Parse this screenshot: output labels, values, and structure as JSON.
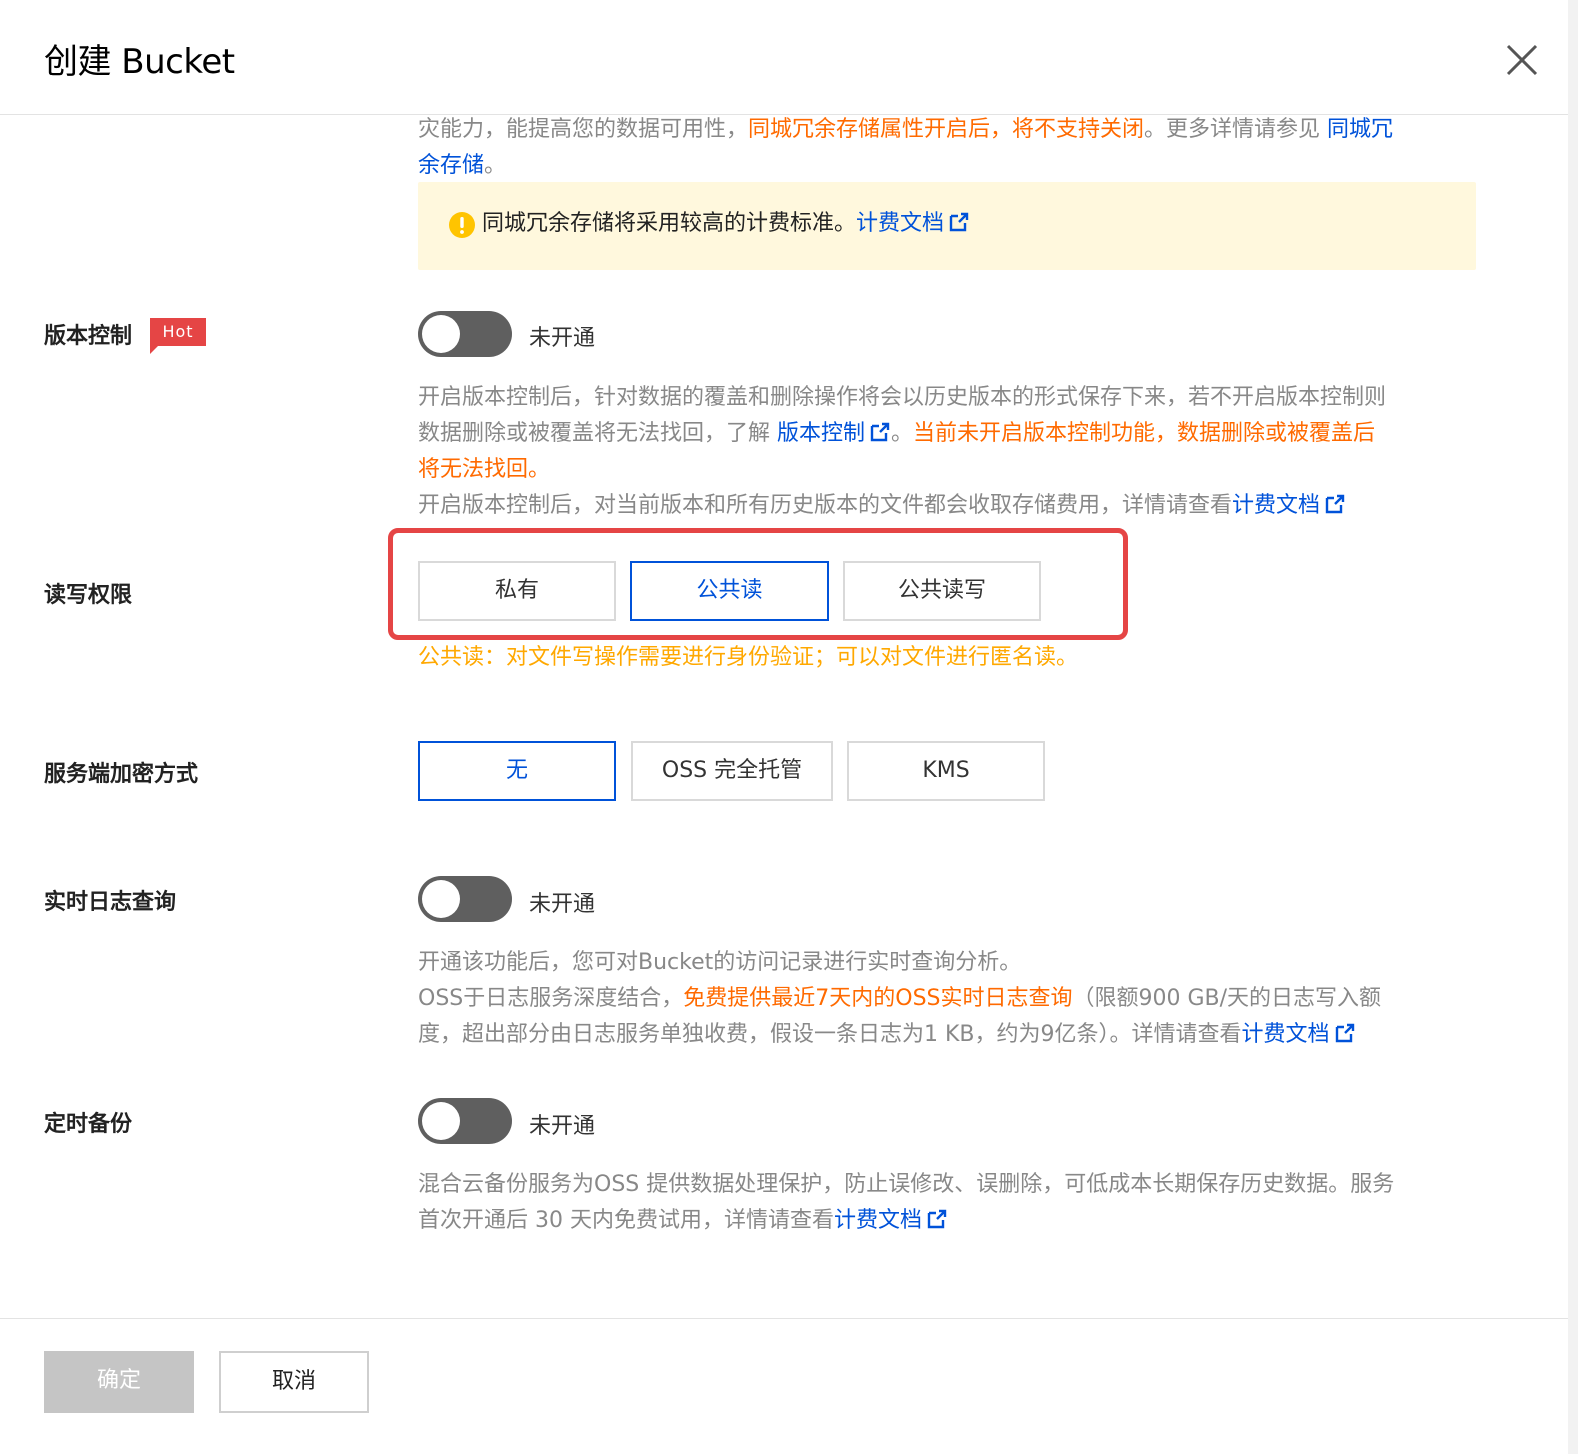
{
  "dialog": {
    "title": "创建 Bucket"
  },
  "redundancy": {
    "text_a": "灾能力，能提高您的数据可用性，",
    "text_b": "同城冗余存储属性开启后，将不支持关闭",
    "text_c": "。更多详情请参见 ",
    "link_a": "同城冗",
    "link_b": "余存储",
    "text_d": "。",
    "notice_text": "同城冗余存储将采用较高的计费标准。",
    "notice_link": "计费文档"
  },
  "versioning": {
    "label": "版本控制",
    "badge": "Hot",
    "toggle_state": "未开通",
    "desc1_a": "开启版本控制后，针对数据的覆盖和删除操作将会以历史版本的形式保存下来，若不开启版本控制则",
    "desc1_b": "数据删除或被覆盖将无法找回，了解 ",
    "desc1_link": "版本控制",
    "desc1_c": "。",
    "desc1_warn1": "当前未开启版本控制功能，数据删除或被覆盖后",
    "desc1_warn2": "将无法找回。",
    "desc2": "开启版本控制后，对当前版本和所有历史版本的文件都会收取存储费用，详情请查看",
    "desc2_link": "计费文档"
  },
  "acl": {
    "label": "读写权限",
    "options": [
      "私有",
      "公共读",
      "公共读写"
    ],
    "selected": "公共读",
    "hint": "公共读：对文件写操作需要进行身份验证；可以对文件进行匿名读。"
  },
  "encryption": {
    "label": "服务端加密方式",
    "options": [
      "无",
      "OSS 完全托管",
      "KMS"
    ],
    "selected": "无"
  },
  "realtime_log": {
    "label": "实时日志查询",
    "toggle_state": "未开通",
    "desc1": "开通该功能后，您可对Bucket的访问记录进行实时查询分析。",
    "desc2_a": "OSS于日志服务深度结合，",
    "desc2_b": "免费提供最近7天内的OSS实时日志查询",
    "desc2_c": "（限额900 GB/天的日志写入额",
    "desc3": "度，超出部分由日志服务单独收费，假设一条日志为1 KB，约为9亿条）。详情请查看",
    "desc3_link": "计费文档"
  },
  "backup": {
    "label": "定时备份",
    "toggle_state": "未开通",
    "desc1": "混合云备份服务为OSS 提供数据处理保护，防止误修改、误删除，可低成本长期保存历史数据。服务",
    "desc2": "首次开通后 30 天内免费试用，详情请查看",
    "desc2_link": "计费文档"
  },
  "footer": {
    "ok_label": "确定",
    "cancel_label": "取消"
  },
  "colors": {
    "link": "#0052d9",
    "warning": "#ff6a00",
    "hint": "#ffa800",
    "highlight": "#e54545"
  }
}
